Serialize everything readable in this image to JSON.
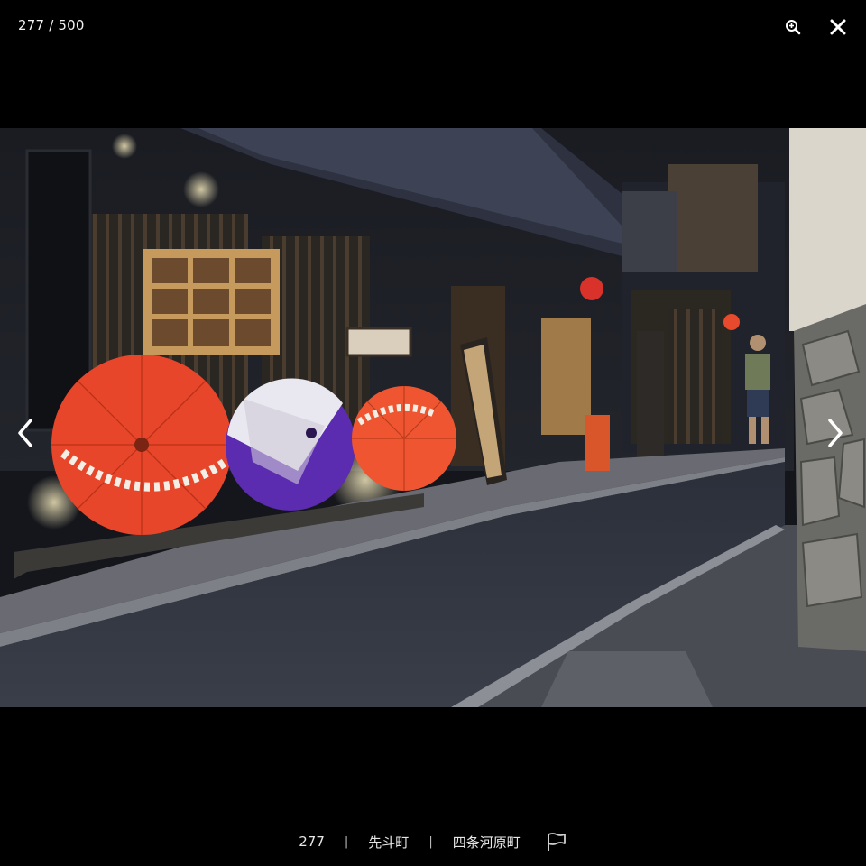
{
  "viewer": {
    "counter": "277 / 500"
  },
  "photo": {
    "alt": "Night street with red and purple parasols in front of a restaurant"
  },
  "caption": {
    "number": "277",
    "separator": "|",
    "location": "先斗町",
    "area": "四条河原町"
  },
  "icons": {
    "zoom": "zoom-in-icon",
    "close": "close-icon",
    "prev": "chevron-left-icon",
    "next": "chevron-right-icon",
    "report": "flag-icon"
  },
  "colors": {
    "background": "#000000",
    "text": "#e6e6e6",
    "parasol_red": "#e8462a",
    "parasol_purple": "#5b2bb0"
  }
}
